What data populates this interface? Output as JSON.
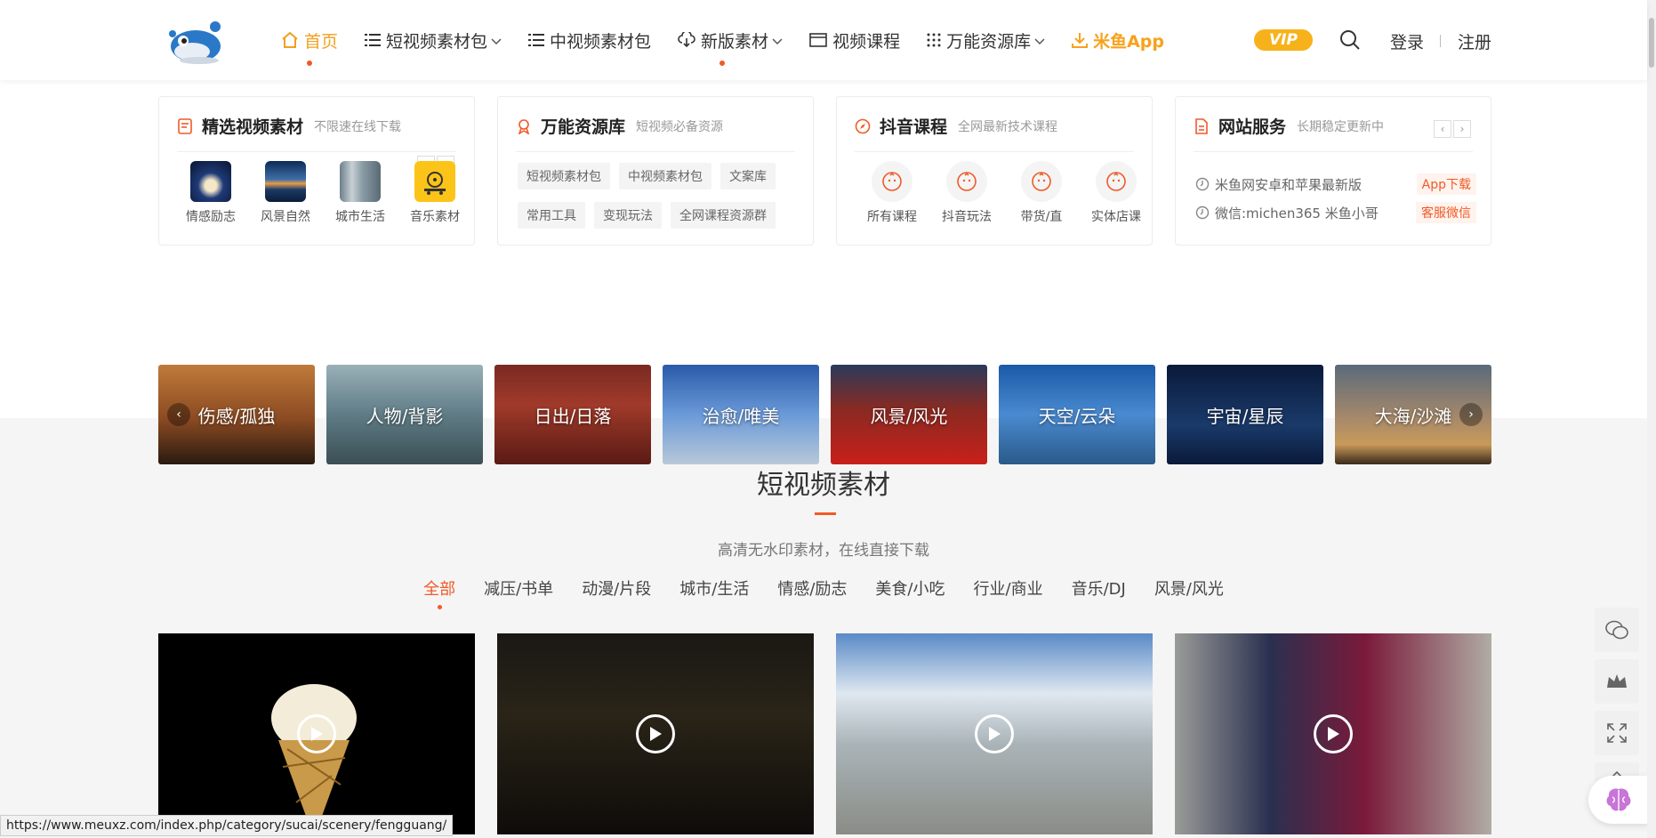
{
  "header": {
    "nav": [
      {
        "label": "首页",
        "icon": "home-icon",
        "active": true
      },
      {
        "label": "短视频素材包",
        "icon": "list-icon",
        "caret": true
      },
      {
        "label": "中视频素材包",
        "icon": "list-icon"
      },
      {
        "label": "新版素材",
        "icon": "cloud-download-icon",
        "caret": true,
        "dot": true
      },
      {
        "label": "视频课程",
        "icon": "window-icon"
      },
      {
        "label": "万能资源库",
        "icon": "grid-icon",
        "caret": true
      },
      {
        "label": "米鱼App",
        "icon": "download-icon",
        "app": true
      }
    ],
    "vip_label": "VIP",
    "login_label": "登录",
    "register_label": "注册"
  },
  "cards": {
    "featured": {
      "title": "精选视频素材",
      "sub": "不限速在线下载",
      "items": [
        {
          "label": "情感励志"
        },
        {
          "label": "风景自然"
        },
        {
          "label": "城市生活"
        },
        {
          "label": "音乐素材"
        }
      ]
    },
    "library": {
      "title": "万能资源库",
      "sub": "短视频必备资源",
      "tags": [
        "短视频素材包",
        "中视频素材包",
        "文案库",
        "常用工具",
        "变现玩法",
        "全网课程资源群"
      ]
    },
    "douyin": {
      "title": "抖音课程",
      "sub": "全网最新技术课程",
      "items": [
        "所有课程",
        "抖音玩法",
        "带货/直",
        "实体店课"
      ]
    },
    "service": {
      "title": "网站服务",
      "sub": "长期稳定更新中",
      "rows": [
        {
          "text": "米鱼网安卓和苹果最新版",
          "btn": "App下载"
        },
        {
          "text": "微信:michen365 米鱼小哥",
          "btn": "客服微信"
        }
      ]
    }
  },
  "banners": [
    "伤感/孤独",
    "人物/背影",
    "日出/日落",
    "治愈/唯美",
    "风景/风光",
    "天空/云朵",
    "宇宙/星辰",
    "大海/沙滩"
  ],
  "section": {
    "title": "短视频素材",
    "subtitle": "高清无水印素材，在线直接下载",
    "filters": [
      "全部",
      "减压/书单",
      "动漫/片段",
      "城市/生活",
      "情感/励志",
      "美食/小吃",
      "行业/商业",
      "音乐/DJ",
      "风景/风光"
    ]
  },
  "status_url": "https://www.meuxz.com/index.php/category/sucai/scenery/fengguang/"
}
